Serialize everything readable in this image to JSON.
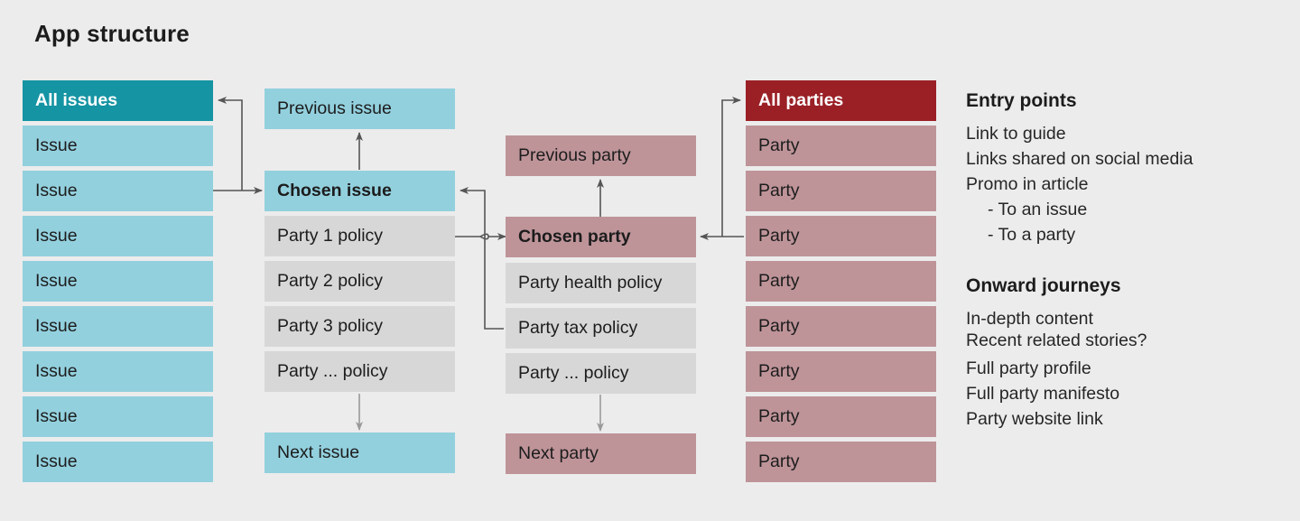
{
  "title": "App structure",
  "colors": {
    "background": "#ececec",
    "teal": "#1594a3",
    "light_blue": "#93d0de",
    "dark_red": "#9a2026",
    "mauve": "#be9499",
    "grey": "#d7d7d7",
    "arrow": "#555555",
    "arrow_light": "#9a9a9a"
  },
  "columns": {
    "all_issues": {
      "header": "All issues",
      "items": [
        "Issue",
        "Issue",
        "Issue",
        "Issue",
        "Issue",
        "Issue",
        "Issue",
        "Issue"
      ]
    },
    "issue_detail": {
      "previous": "Previous issue",
      "chosen": "Chosen issue",
      "policies": [
        "Party 1 policy",
        "Party 2 policy",
        "Party 3 policy",
        "Party ... policy"
      ],
      "next": "Next issue"
    },
    "party_detail": {
      "previous": "Previous party",
      "chosen": "Chosen party",
      "policies": [
        "Party health policy",
        "Party tax policy",
        "Party ... policy"
      ],
      "next": "Next party"
    },
    "all_parties": {
      "header": "All parties",
      "items": [
        "Party",
        "Party",
        "Party",
        "Party",
        "Party",
        "Party",
        "Party",
        "Party"
      ]
    }
  },
  "notes": {
    "entry": {
      "heading": "Entry points",
      "lines": [
        "Link to guide",
        "Links shared on social media",
        "Promo in article",
        "- To an issue",
        "- To a party"
      ]
    },
    "onward": {
      "heading": "Onward journeys",
      "lines": [
        "In-depth content",
        "Recent related stories?",
        "Full party profile",
        "Full party manifesto",
        "Party website link"
      ]
    }
  }
}
